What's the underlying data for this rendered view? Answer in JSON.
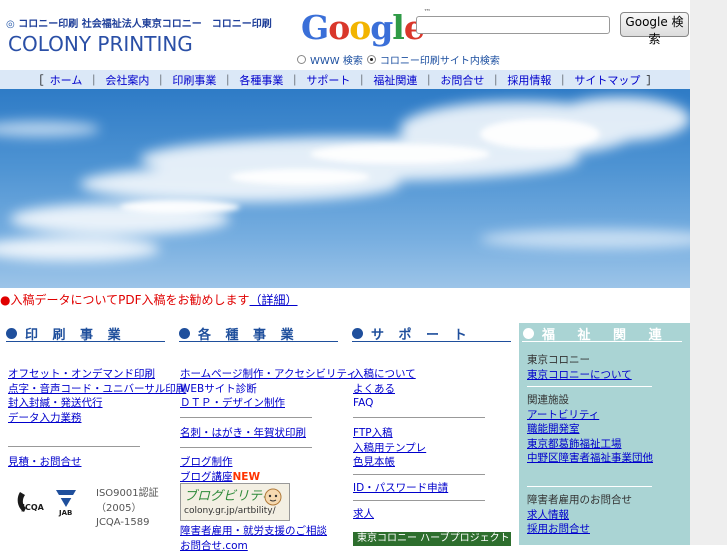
{
  "header": {
    "org_line": "コロニー印刷 社会福祉法人東京コロニー　コロニー印刷",
    "logo_text": "COLONY PRINTING",
    "google_logo": "Google",
    "search": {
      "value": "",
      "placeholder": "",
      "button_label": "Google 検索"
    },
    "radio_options": [
      {
        "label": "WWW 検索",
        "selected": false
      },
      {
        "label": "コロニー印刷サイト内検索",
        "selected": true
      }
    ]
  },
  "nav": {
    "items": [
      "ホーム",
      "会社案内",
      "印刷事業",
      "各種事業",
      "サポート",
      "福祉関連",
      "お問合せ",
      "採用情報",
      "サイトマップ"
    ]
  },
  "notice": {
    "bullet": "●",
    "red_text": "入稿データについてPDF入稿をお勧めします",
    "link_text": "（詳細）"
  },
  "sections": {
    "printing": {
      "title": "印 刷 事 業",
      "links": [
        "オフセット・オンデマンド印刷",
        "点字・音声コード・ユニバーサル印刷",
        "封入封緘・発送代行",
        "データ入力業務"
      ],
      "links2": [
        "見積・お問合せ"
      ],
      "iso_lines": [
        "ISO9001認証",
        "（2005）",
        "JCQA-1589"
      ],
      "badge_labels": [
        "JCQA",
        "JAB"
      ]
    },
    "business": {
      "title": "各 種 事 業",
      "links": [
        "ホームページ制作・アクセシビリティ",
        "WEBサイト診断",
        "ＤＴＰ・デザイン制作"
      ],
      "links2": [
        "名刺・はがき・年賀状印刷"
      ],
      "links3": [
        "ブログ制作",
        "ブログ講座"
      ],
      "new_label": "NEW",
      "blog_banner": {
        "title": "ブログビリティ",
        "url": "colony.gr.jp/artbility/"
      },
      "links4": [
        "障害者雇用・就労支援のご相談",
        "お問合せ.com"
      ]
    },
    "support": {
      "title": "サ ポ ー ト",
      "links": [
        "入稿について",
        "よくある",
        "FAQ"
      ],
      "links2": [
        "FTP入稿",
        "入稿用テンプレ",
        "色見本帳"
      ],
      "links3": [
        "ID・パスワード申請"
      ],
      "links4": [
        "求人"
      ],
      "herb_banner": "東京コロニー ハーブプロジェクト"
    },
    "welfare": {
      "title": "福 祉 関 連",
      "groups": [
        {
          "label": "東京コロニー",
          "links": [
            "東京コロニーについて"
          ]
        },
        {
          "label": "関連施設",
          "links": [
            "アートビリティ",
            "職能開発室",
            "東京都葛飾福祉工場",
            "中野区障害者福祉事業団他"
          ]
        },
        {
          "label": "障害者雇用のお問合せ",
          "links": [
            "求人情報",
            "採用お問合せ"
          ]
        }
      ]
    }
  },
  "colors": {
    "nav_bg": "#dbe8f7",
    "section_blue": "#1f4f9c",
    "welfare_bg": "#aad4d4",
    "link": "#0000cc",
    "notice_red": "#e00000"
  }
}
